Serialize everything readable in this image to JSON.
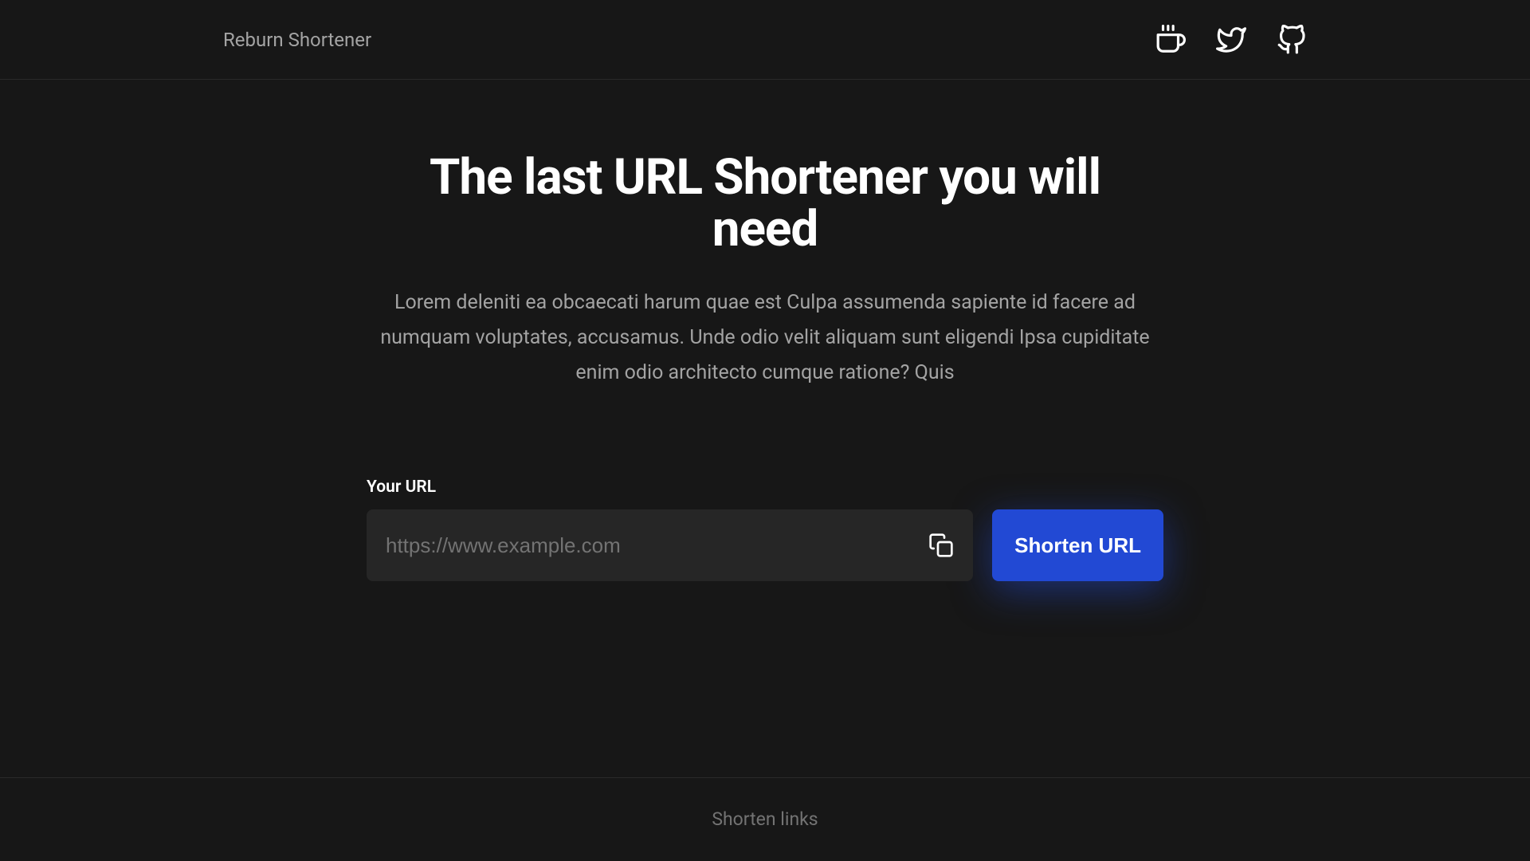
{
  "header": {
    "logo": "Reburn Shortener"
  },
  "hero": {
    "title": "The last URL Shortener you will need",
    "description": "Lorem deleniti ea obcaecati harum quae est Culpa assumenda sapiente id facere ad numquam voluptates, accusamus. Unde odio velit aliquam sunt eligendi Ipsa cupiditate enim odio architecto cumque ratione? Quis"
  },
  "form": {
    "label": "Your URL",
    "placeholder": "https://www.example.com",
    "button": "Shorten URL"
  },
  "footer": {
    "text": "Shorten links"
  }
}
